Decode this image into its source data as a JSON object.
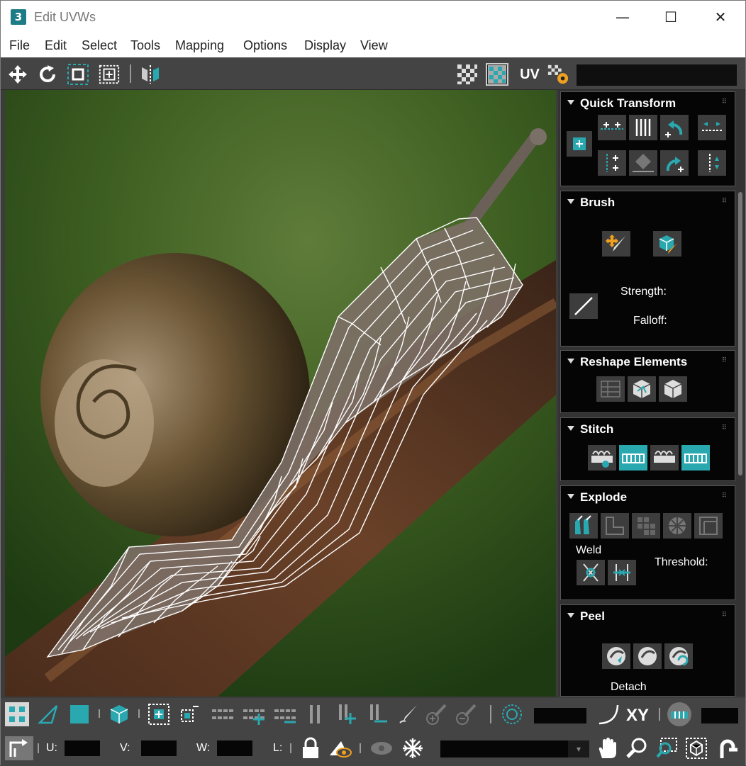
{
  "window": {
    "title": "Edit UVWs",
    "app_glyph": "3"
  },
  "window_controls": {
    "minimize": "—",
    "maximize": "☐",
    "close": "✕"
  },
  "menu": [
    "File",
    "Edit",
    "Select",
    "Tools",
    "Mapping",
    "Options",
    "Display",
    "View"
  ],
  "toolbar": {
    "uv_label": "UV"
  },
  "rollouts": {
    "quick_transform": {
      "title": "Quick Transform"
    },
    "brush": {
      "title": "Brush",
      "strength_label": "Strength:",
      "falloff_label": "Falloff:"
    },
    "reshape": {
      "title": "Reshape Elements"
    },
    "stitch": {
      "title": "Stitch"
    },
    "explode": {
      "title": "Explode",
      "weld_label": "Weld",
      "threshold_label": "Threshold:"
    },
    "peel": {
      "title": "Peel",
      "detach_label": "Detach"
    }
  },
  "bottom": {
    "xy_label": "XY",
    "u_label": "U:",
    "v_label": "V:",
    "w_label": "W:",
    "l_label": "L:"
  },
  "colors": {
    "accent": "#2aa8b0",
    "panel": "#050505",
    "toolbar": "#444444",
    "highlight": "#f0a020"
  }
}
